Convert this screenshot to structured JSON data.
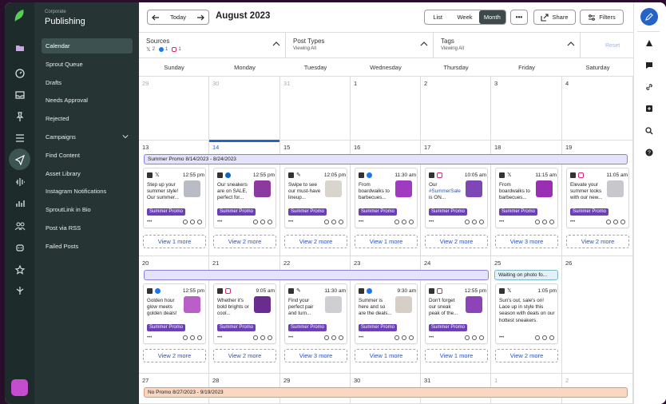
{
  "colors": {
    "accent": "#2563c7",
    "tag": "#6b3fb8",
    "band_purple": "#e5e2fb",
    "band_orange": "#fbd7c2"
  },
  "sidebar": {
    "org": "Corporate",
    "app": "Publishing",
    "items": [
      {
        "label": "Calendar",
        "selected": true
      },
      {
        "label": "Sprout Queue"
      },
      {
        "label": "Drafts"
      },
      {
        "label": "Needs Approval"
      },
      {
        "label": "Rejected"
      },
      {
        "label": "Campaigns",
        "caret": "chevron-down-icon"
      },
      {
        "label": "Find Content"
      },
      {
        "label": "Asset Library"
      },
      {
        "label": "Instagram Notifications"
      },
      {
        "label": "SproutLink in Bio"
      },
      {
        "label": "Post via RSS"
      },
      {
        "label": "Failed Posts"
      }
    ]
  },
  "toolbar": {
    "today": "Today",
    "month_title": "August 2023",
    "views": [
      "List",
      "Week",
      "Month"
    ],
    "active_view": "Month",
    "share": "Share",
    "filters": "Filters",
    "more": "•••"
  },
  "filters": {
    "sources": {
      "title": "Sources",
      "x_count": "2",
      "fb_count": "1",
      "ig_count": "1"
    },
    "post_types": {
      "title": "Post Types",
      "sub": "Viewing All"
    },
    "tags": {
      "title": "Tags",
      "sub": "Viewing All"
    },
    "reset": "Reset"
  },
  "weekdays": [
    "Sunday",
    "Monday",
    "Tuesday",
    "Wednesday",
    "Thursday",
    "Friday",
    "Saturday"
  ],
  "weeks": [
    {
      "days": [
        "29",
        "30",
        "31",
        "1",
        "2",
        "3",
        "4"
      ],
      "muted": [
        true,
        true,
        true,
        false,
        false,
        false,
        false
      ]
    },
    {
      "days": [
        "13",
        "14",
        "15",
        "16",
        "17",
        "18",
        "19"
      ],
      "band": "Summer Promo  8/14/2023 - 8/24/2023",
      "cards": [
        {
          "net": "x",
          "time": "12:55 pm",
          "text": "Step up your summer style! Our summer...",
          "tag": "Summer Promo",
          "thumb": "#b9bcc4",
          "more": "View 1 more"
        },
        {
          "net": "li",
          "time": "12:55 pm",
          "text": "Our sneakers are on SALE, perfect for...",
          "tag": "Summer Promo",
          "thumb": "#8d3aa0",
          "more": "View 2 more"
        },
        {
          "net": "none",
          "time": "12:05 pm",
          "text": "Swipe to see our must-have lineup...",
          "tag": "Summer Promo",
          "thumb": "#d9d4cc",
          "more": "View 2 more"
        },
        {
          "net": "fb",
          "time": "11:30 am",
          "text": "From boardwalks to barbecues...",
          "tag": "Summer Promo",
          "thumb": "#a03ac0",
          "more": "View 1 more"
        },
        {
          "net": "ig",
          "time": "10:05 am",
          "text_pre": "Our ",
          "text_hl": "#SummerSale",
          "text_post": " is ON...",
          "tag": "Summer Promo",
          "thumb": "#7d48b5",
          "more": "View 2 more"
        },
        {
          "net": "x",
          "time": "11:15 am",
          "text": "From boardwalks to barbecues...",
          "tag": "Summer Promo",
          "thumb": "#9a2fb3",
          "more": "View 3 more"
        },
        {
          "net": "ig",
          "time": "11:05 am",
          "text": "Elevate your summer looks with our new...",
          "tag": "Summer Promo",
          "thumb": "#c8c7cd",
          "more": "View 2 more"
        }
      ]
    },
    {
      "days": [
        "20",
        "21",
        "22",
        "23",
        "24",
        "25",
        "26"
      ],
      "band": "",
      "band2": "Waiting on photo fo...",
      "cards": [
        {
          "net": "fb",
          "time": "12:55 pm",
          "text": "Golden hour glow meets golden deals!",
          "tag": "Summer Promo",
          "thumb": "#b95fc7",
          "more": "View 2 more"
        },
        {
          "net": "ig",
          "time": "9:05 am",
          "text": "Whether it's bold brights or cool...",
          "tag": "Summer Promo",
          "thumb": "#6b2c8f",
          "more": "View 2 more"
        },
        {
          "net": "none",
          "time": "11:30 am",
          "text": "Find your perfect pair and turn...",
          "tag": "Summer Promo",
          "thumb": "#cfcfd3",
          "more": "View 3 more"
        },
        {
          "net": "fb",
          "time": "9:30 am",
          "text": "Summer is here and so are the deals...",
          "tag": "Summer Promo",
          "thumb": "#d6cfc7",
          "more": "View 1 more"
        },
        {
          "net": "ig",
          "time": "12:55 pm",
          "text": "Don't forget our sneak peak of the...",
          "tag": "Summer Promo",
          "thumb": "#8c45b8",
          "more": "View 1 more"
        },
        {
          "net": "x",
          "time": "1:05 pm",
          "text": "Sun's out, sale's on! Lace up in style this season with deals on our hottest sneakers.",
          "tag": "",
          "thumb": "",
          "more": "View 2 more"
        }
      ]
    },
    {
      "days": [
        "27",
        "28",
        "29",
        "30",
        "31",
        "1",
        "2"
      ],
      "muted": [
        false,
        false,
        false,
        false,
        false,
        true,
        true
      ],
      "band": "No Promo  8/27/2023 - 9/19/2023"
    }
  ]
}
